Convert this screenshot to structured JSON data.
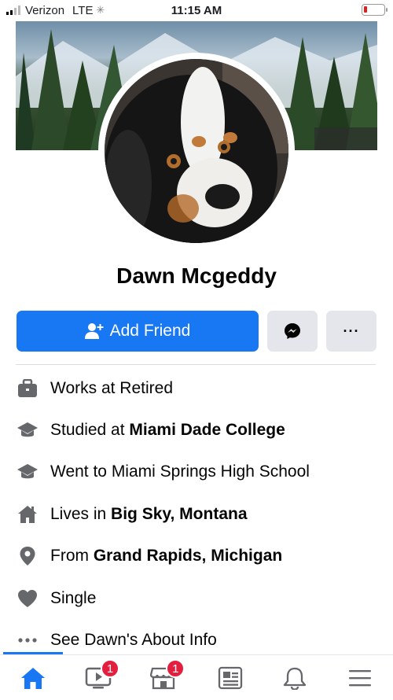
{
  "status_bar": {
    "carrier": "Verizon",
    "network": "LTE",
    "time": "11:15 AM",
    "battery_level": 0.15
  },
  "profile": {
    "name": "Dawn Mcgeddy"
  },
  "actions": {
    "add_friend_label": "Add Friend",
    "more_label": "···"
  },
  "details": [
    {
      "icon": "briefcase-icon",
      "prefix": "Works at Retired",
      "bold": ""
    },
    {
      "icon": "graduation-cap-icon",
      "prefix": "Studied at ",
      "bold": "Miami Dade College"
    },
    {
      "icon": "graduation-cap-icon",
      "prefix": "Went to Miami Springs High School",
      "bold": ""
    },
    {
      "icon": "home-icon",
      "prefix": "Lives in ",
      "bold": "Big Sky, Montana"
    },
    {
      "icon": "location-pin-icon",
      "prefix": "From ",
      "bold": "Grand Rapids, Michigan"
    },
    {
      "icon": "heart-icon",
      "prefix": "Single",
      "bold": ""
    },
    {
      "icon": "more-dots-icon",
      "prefix": "See Dawn's About Info",
      "bold": ""
    }
  ],
  "bottom_nav": [
    {
      "name": "home",
      "badge": "",
      "active": true
    },
    {
      "name": "watch",
      "badge": "1"
    },
    {
      "name": "marketplace",
      "badge": "1"
    },
    {
      "name": "news",
      "badge": ""
    },
    {
      "name": "notifications",
      "badge": ""
    },
    {
      "name": "menu",
      "badge": ""
    }
  ],
  "colors": {
    "accent": "#1877f2",
    "badge": "#e41e3f",
    "button_gray": "#e4e6eb",
    "icon_gray": "#65676b"
  }
}
